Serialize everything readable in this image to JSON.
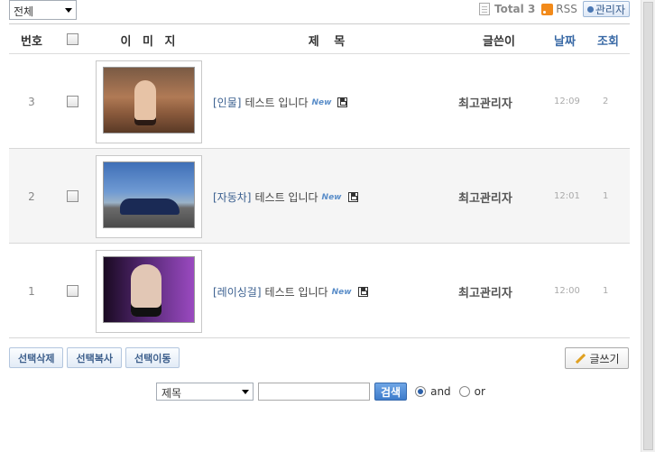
{
  "category_select": {
    "value": "전체"
  },
  "header": {
    "total": "Total 3",
    "rss": "RSS",
    "admin": "관리자"
  },
  "columns": {
    "no": "번호",
    "image": "이 미 지",
    "title": "제  목",
    "writer": "글쓴이",
    "date": "날짜",
    "views": "조회"
  },
  "posts": [
    {
      "no": "3",
      "category": "[인물]",
      "title": "테스트 입니다",
      "new_badge": "New",
      "writer": "최고관리자",
      "date": "12:09",
      "views": "2",
      "thumb": "portrait-woman-desert"
    },
    {
      "no": "2",
      "category": "[자동차]",
      "title": "테스트 입니다",
      "new_badge": "New",
      "writer": "최고관리자",
      "date": "12:01",
      "views": "1",
      "thumb": "blue-sports-car"
    },
    {
      "no": "1",
      "category": "[레이싱걸]",
      "title": "테스트 입니다",
      "new_badge": "New",
      "writer": "최고관리자",
      "date": "12:00",
      "views": "1",
      "thumb": "portrait-woman-purple"
    }
  ],
  "actions": {
    "delete": "선택삭제",
    "copy": "선택복사",
    "move": "선택이동",
    "write": "글쓰기"
  },
  "search": {
    "field": "제목",
    "query": "",
    "submit": "검색",
    "op_and": "and",
    "op_or": "or",
    "selected_op": "and"
  },
  "icons": [
    "document-icon",
    "rss-icon",
    "admin-pin-icon",
    "new-icon",
    "file-icon",
    "pencil-icon"
  ],
  "colors": {
    "accent": "#3a6aa6",
    "search_button": "#3e7ccb",
    "rss": "#f28a1a"
  }
}
